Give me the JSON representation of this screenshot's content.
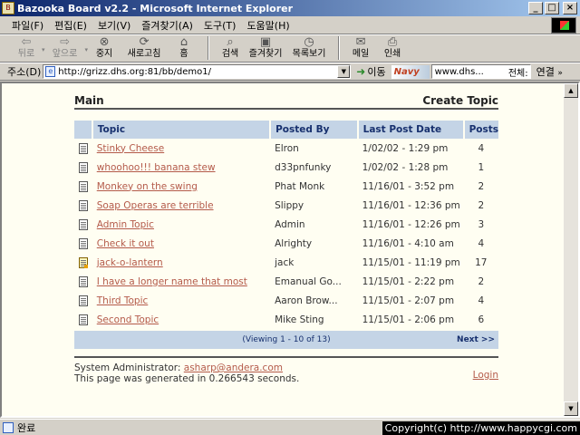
{
  "window": {
    "title": "Bazooka Board v2.2 - Microsoft Internet Explorer",
    "minimize": "_",
    "maximize": "□",
    "close": "×"
  },
  "menu": [
    "파일(F)",
    "편집(E)",
    "보기(V)",
    "즐겨찾기(A)",
    "도구(T)",
    "도움말(H)"
  ],
  "toolbar": {
    "back": "뒤로",
    "forward": "앞으로",
    "stop": "중지",
    "refresh": "새로고침",
    "home": "홈",
    "search": "검색",
    "favorites": "즐겨찾기",
    "history": "목록보기",
    "mail": "메일",
    "print": "인쇄"
  },
  "address": {
    "label": "주소(D)",
    "url": "http://grizz.dhs.org:81/bb/demo1/",
    "go": "이동",
    "navy": "Navy",
    "search_value": "www.dhs...",
    "search_scope": "전체:",
    "links": "연결"
  },
  "board": {
    "main_title": "Main",
    "create_topic": "Create Topic",
    "columns": {
      "topic": "Topic",
      "posted_by": "Posted By",
      "last_post": "Last Post Date",
      "posts": "Posts"
    },
    "topics": [
      {
        "title": "Stinky Cheese",
        "author": "Elron",
        "last_post": "1/02/02 - 1:29 pm",
        "posts": "4",
        "hot": false
      },
      {
        "title": "whoohoo!!! banana stew",
        "author": "d33pnfunky",
        "last_post": "1/02/02 - 1:28 pm",
        "posts": "1",
        "hot": false
      },
      {
        "title": "Monkey on the swing",
        "author": "Phat Monk",
        "last_post": "11/16/01 - 3:52 pm",
        "posts": "2",
        "hot": false
      },
      {
        "title": "Soap Operas are terrible",
        "author": "Slippy",
        "last_post": "11/16/01 - 12:36 pm",
        "posts": "2",
        "hot": false
      },
      {
        "title": "Admin Topic",
        "author": "Admin",
        "last_post": "11/16/01 - 12:26 pm",
        "posts": "3",
        "hot": false
      },
      {
        "title": "Check it out",
        "author": "Alrighty",
        "last_post": "11/16/01 - 4:10 am",
        "posts": "4",
        "hot": false
      },
      {
        "title": "jack-o-lantern",
        "author": "jack",
        "last_post": "11/15/01 - 11:19 pm",
        "posts": "17",
        "hot": true
      },
      {
        "title": "I have a longer name that most",
        "author": "Emanual Go...",
        "last_post": "11/15/01 - 2:22 pm",
        "posts": "2",
        "hot": false
      },
      {
        "title": "Third Topic",
        "author": "Aaron Brow...",
        "last_post": "11/15/01 - 2:07 pm",
        "posts": "4",
        "hot": false
      },
      {
        "title": "Second Topic",
        "author": "Mike Sting",
        "last_post": "11/15/01 - 2:06 pm",
        "posts": "6",
        "hot": false
      }
    ],
    "viewing": "(Viewing 1 - 10 of 13)",
    "next": "Next >>",
    "admin_label": "System Administrator:",
    "admin_email": "asharp@andera.com",
    "generated": "This page was generated in 0.266543 seconds.",
    "login": "Login"
  },
  "status": {
    "text": "완료",
    "copyright": "Copyright(c) http://www.happycgi.com"
  }
}
